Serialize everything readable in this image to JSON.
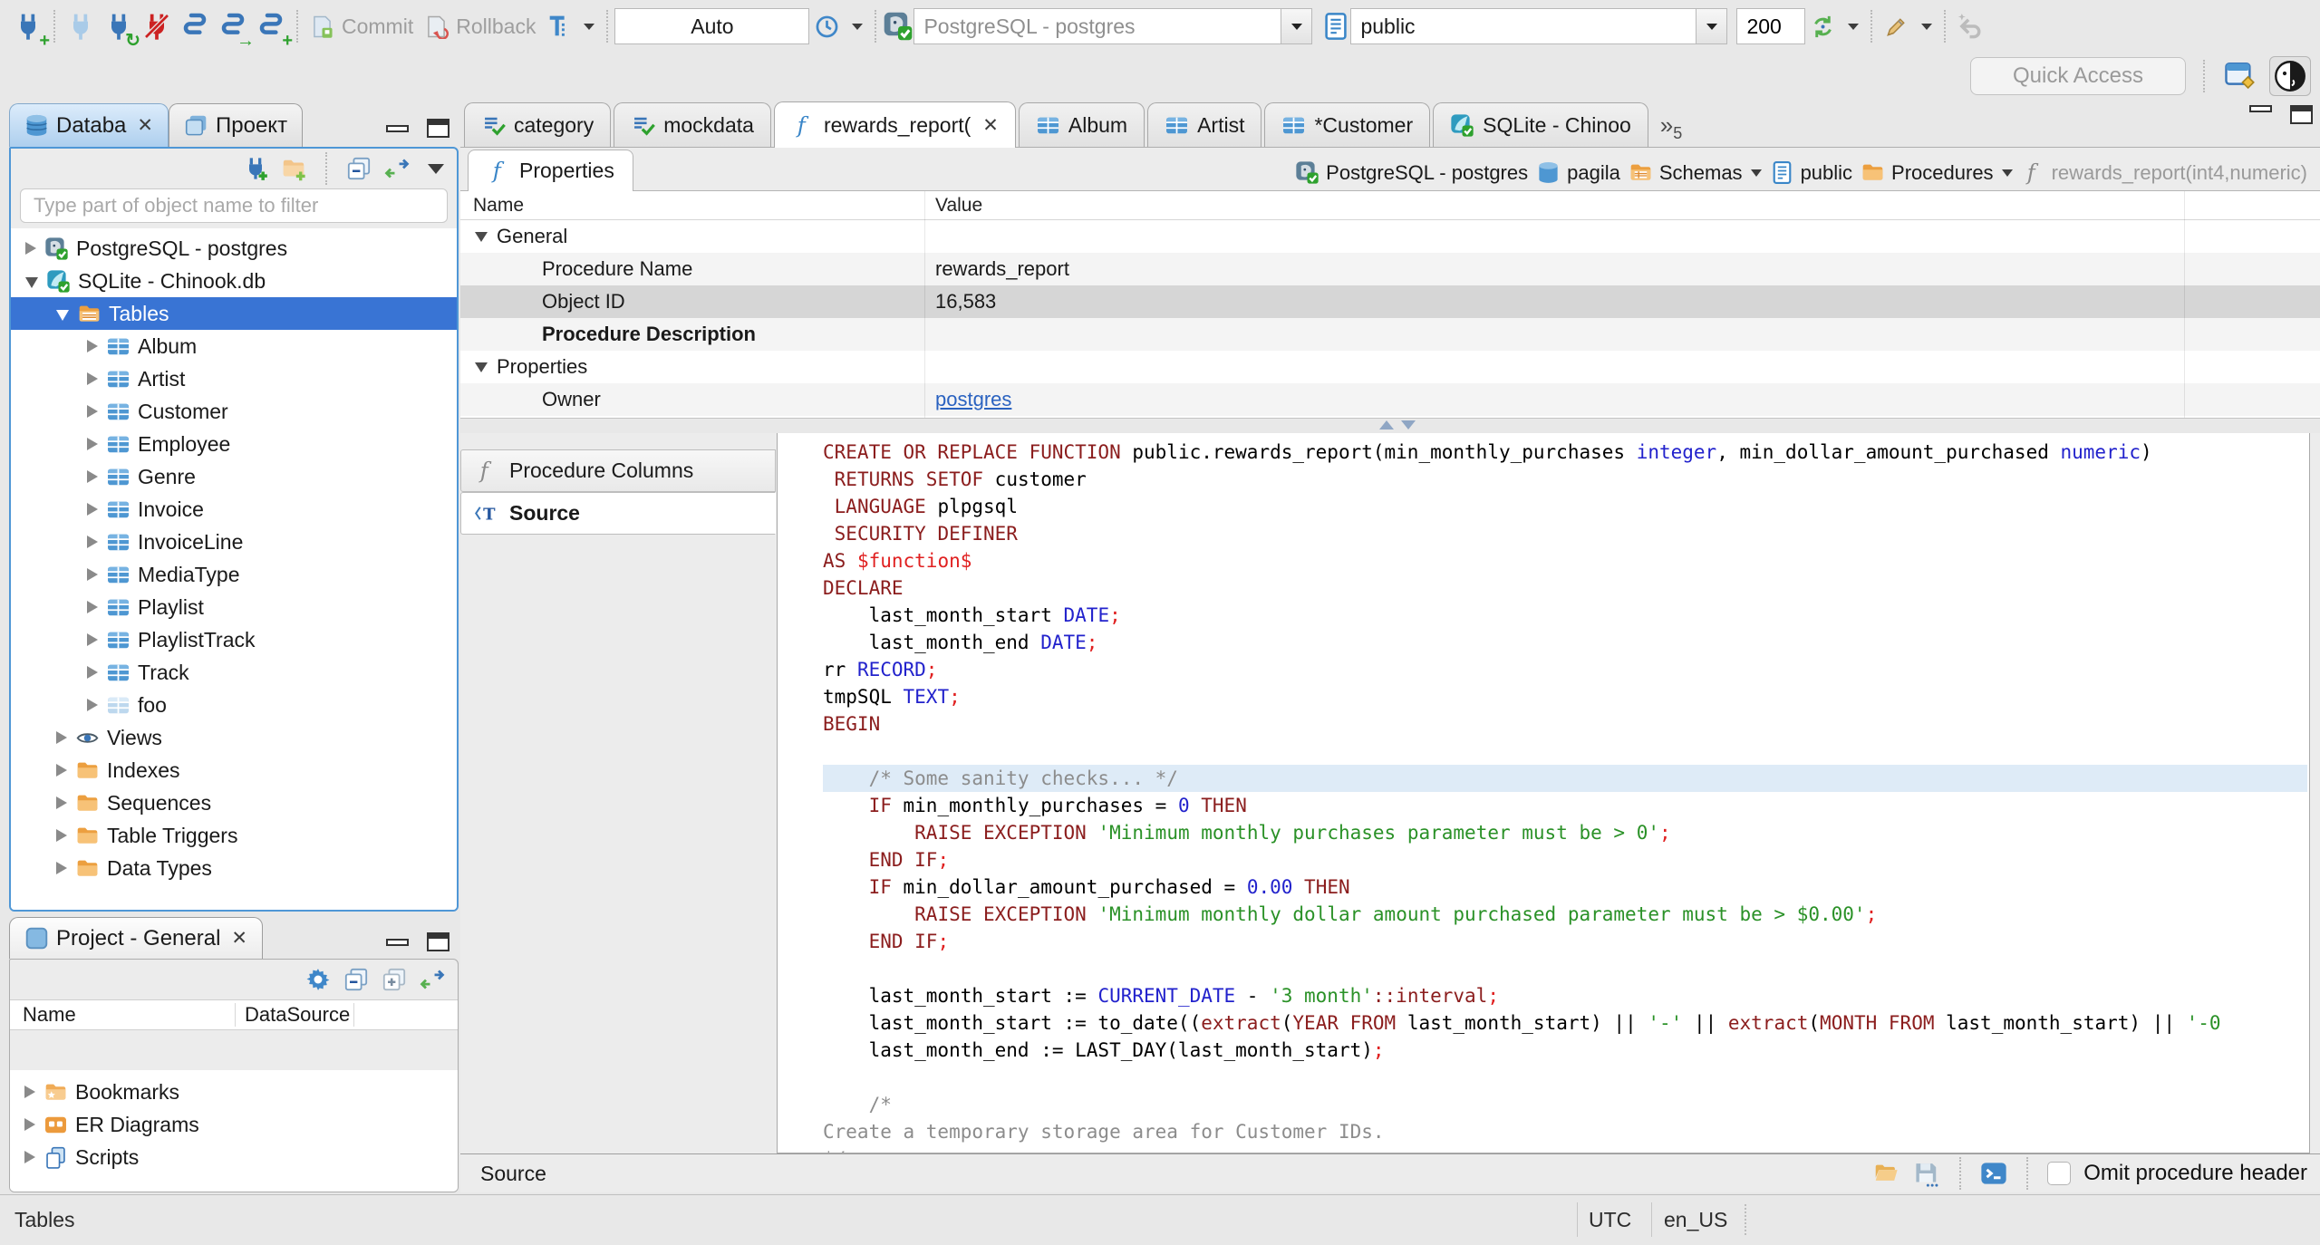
{
  "icons_glyphs": {
    "close": "✕",
    "more": "»",
    "refresh_badge": "↻",
    "plus_badge": "+"
  },
  "toolbar": {
    "commit_label": "Commit",
    "rollback_label": "Rollback",
    "auto_value": "Auto",
    "connection_value": "PostgreSQL - postgres",
    "schema_value": "public",
    "fetch_size_value": "200",
    "quick_access_placeholder": "Quick Access"
  },
  "navigator": {
    "tab_database": "Databa",
    "tab_project": "Проект",
    "filter_placeholder": "Type part of object name to filter",
    "tree": [
      {
        "label": "PostgreSQL - postgres",
        "depth": 0,
        "state": "collapsed",
        "icon": "pg"
      },
      {
        "label": "SQLite - Chinook.db",
        "depth": 0,
        "state": "expanded",
        "icon": "sqlite"
      },
      {
        "label": "Tables",
        "depth": 1,
        "state": "expanded",
        "icon": "tablesfolder",
        "selected": true
      },
      {
        "label": "Album",
        "depth": 2,
        "state": "collapsed",
        "icon": "table"
      },
      {
        "label": "Artist",
        "depth": 2,
        "state": "collapsed",
        "icon": "table"
      },
      {
        "label": "Customer",
        "depth": 2,
        "state": "collapsed",
        "icon": "table"
      },
      {
        "label": "Employee",
        "depth": 2,
        "state": "collapsed",
        "icon": "table"
      },
      {
        "label": "Genre",
        "depth": 2,
        "state": "collapsed",
        "icon": "table"
      },
      {
        "label": "Invoice",
        "depth": 2,
        "state": "collapsed",
        "icon": "table"
      },
      {
        "label": "InvoiceLine",
        "depth": 2,
        "state": "collapsed",
        "icon": "table"
      },
      {
        "label": "MediaType",
        "depth": 2,
        "state": "collapsed",
        "icon": "table"
      },
      {
        "label": "Playlist",
        "depth": 2,
        "state": "collapsed",
        "icon": "table"
      },
      {
        "label": "PlaylistTrack",
        "depth": 2,
        "state": "collapsed",
        "icon": "table"
      },
      {
        "label": "Track",
        "depth": 2,
        "state": "collapsed",
        "icon": "table"
      },
      {
        "label": "foo",
        "depth": 2,
        "state": "collapsed",
        "icon": "tablepale"
      },
      {
        "label": "Views",
        "depth": 1,
        "state": "collapsed",
        "icon": "views"
      },
      {
        "label": "Indexes",
        "depth": 1,
        "state": "collapsed",
        "icon": "folder"
      },
      {
        "label": "Sequences",
        "depth": 1,
        "state": "collapsed",
        "icon": "folder"
      },
      {
        "label": "Table Triggers",
        "depth": 1,
        "state": "collapsed",
        "icon": "folder"
      },
      {
        "label": "Data Types",
        "depth": 1,
        "state": "collapsed",
        "icon": "folder"
      }
    ]
  },
  "project_panel": {
    "title": "Project - General",
    "columns": [
      "Name",
      "DataSource"
    ],
    "tree": [
      {
        "label": "Bookmarks",
        "icon": "bookmarks"
      },
      {
        "label": "ER Diagrams",
        "icon": "erd"
      },
      {
        "label": "Scripts",
        "icon": "scripts"
      }
    ]
  },
  "editor": {
    "tabs": [
      {
        "label": "category",
        "icon": "script"
      },
      {
        "label": "mockdata",
        "icon": "script"
      },
      {
        "label": "rewards_report(",
        "icon": "fx",
        "active": true,
        "closable": true
      },
      {
        "label": "Album",
        "icon": "table"
      },
      {
        "label": "Artist",
        "icon": "table"
      },
      {
        "label": "*Customer",
        "icon": "table"
      },
      {
        "label": "SQLite - Chinoo",
        "icon": "sqlite"
      }
    ],
    "hidden_tabs_count": "5",
    "properties_tab_label": "Properties",
    "breadcrumb": [
      {
        "label": "PostgreSQL - postgres",
        "icon": "pg"
      },
      {
        "label": "pagila",
        "icon": "dbcyl"
      },
      {
        "label": "Schemas",
        "icon": "schemafolder",
        "caret": true
      },
      {
        "label": "public",
        "icon": "page"
      },
      {
        "label": "Procedures",
        "icon": "folder",
        "caret": true
      },
      {
        "label": "rewards_report(int4,numeric)",
        "icon": "fxgray",
        "dim": true
      }
    ],
    "grid": {
      "name_col": "Name",
      "value_col": "Value",
      "rows": [
        {
          "kind": "group",
          "name": "General"
        },
        {
          "kind": "item",
          "name": "Procedure Name",
          "value": "rewards_report"
        },
        {
          "kind": "item",
          "name": "Object ID",
          "value": "16,583",
          "selected": true
        },
        {
          "kind": "item",
          "name": "Procedure Description",
          "value": "",
          "bold": true
        },
        {
          "kind": "group",
          "name": "Properties"
        },
        {
          "kind": "item",
          "name": "Owner",
          "value": "postgres",
          "link": true
        }
      ]
    },
    "subtabs": [
      {
        "label": "Procedure Columns",
        "icon": "fxgray"
      },
      {
        "label": "Source",
        "icon": "sourceT",
        "active": true
      }
    ],
    "source_lines": [
      {
        "hl": false,
        "tokens": [
          [
            "k",
            "CREATE OR REPLACE FUNCTION"
          ],
          [
            "p",
            " public.rewards_report(min_monthly_purchases "
          ],
          [
            "t",
            "integer"
          ],
          [
            "p",
            ", min_dollar_amount_purchased "
          ],
          [
            "t",
            "numeric"
          ],
          [
            "p",
            ")"
          ]
        ]
      },
      {
        "hl": false,
        "tokens": [
          [
            "p",
            " "
          ],
          [
            "k",
            "RETURNS SETOF"
          ],
          [
            "p",
            " customer"
          ]
        ]
      },
      {
        "hl": false,
        "tokens": [
          [
            "p",
            " "
          ],
          [
            "k",
            "LANGUAGE"
          ],
          [
            "p",
            " plpgsql"
          ]
        ]
      },
      {
        "hl": false,
        "tokens": [
          [
            "p",
            " "
          ],
          [
            "k",
            "SECURITY DEFINER"
          ]
        ]
      },
      {
        "hl": false,
        "tokens": [
          [
            "k",
            "AS"
          ],
          [
            "r",
            " $function$"
          ]
        ]
      },
      {
        "hl": false,
        "tokens": [
          [
            "k",
            "DECLARE"
          ]
        ]
      },
      {
        "hl": false,
        "tokens": [
          [
            "p",
            "    last_month_start "
          ],
          [
            "t",
            "DATE"
          ],
          [
            "r",
            ";"
          ]
        ]
      },
      {
        "hl": false,
        "tokens": [
          [
            "p",
            "    last_month_end "
          ],
          [
            "t",
            "DATE"
          ],
          [
            "r",
            ";"
          ]
        ]
      },
      {
        "hl": false,
        "tokens": [
          [
            "p",
            "rr "
          ],
          [
            "t",
            "RECORD"
          ],
          [
            "r",
            ";"
          ]
        ]
      },
      {
        "hl": false,
        "tokens": [
          [
            "p",
            "tmpSQL "
          ],
          [
            "t",
            "TEXT"
          ],
          [
            "r",
            ";"
          ]
        ]
      },
      {
        "hl": false,
        "tokens": [
          [
            "k",
            "BEGIN"
          ]
        ]
      },
      {
        "hl": false,
        "tokens": []
      },
      {
        "hl": true,
        "tokens": [
          [
            "c",
            "    /* Some sanity checks... */"
          ]
        ]
      },
      {
        "hl": false,
        "tokens": [
          [
            "p",
            "    "
          ],
          [
            "k",
            "IF"
          ],
          [
            "p",
            " min_monthly_purchases = "
          ],
          [
            "n",
            "0"
          ],
          [
            "p",
            " "
          ],
          [
            "k",
            "THEN"
          ]
        ]
      },
      {
        "hl": false,
        "tokens": [
          [
            "p",
            "        "
          ],
          [
            "k",
            "RAISE EXCEPTION"
          ],
          [
            "p",
            " "
          ],
          [
            "s",
            "'Minimum monthly purchases parameter must be > 0'"
          ],
          [
            "r",
            ";"
          ]
        ]
      },
      {
        "hl": false,
        "tokens": [
          [
            "p",
            "    "
          ],
          [
            "k",
            "END IF"
          ],
          [
            "r",
            ";"
          ]
        ]
      },
      {
        "hl": false,
        "tokens": [
          [
            "p",
            "    "
          ],
          [
            "k",
            "IF"
          ],
          [
            "p",
            " min_dollar_amount_purchased = "
          ],
          [
            "n",
            "0.00"
          ],
          [
            "p",
            " "
          ],
          [
            "k",
            "THEN"
          ]
        ]
      },
      {
        "hl": false,
        "tokens": [
          [
            "p",
            "        "
          ],
          [
            "k",
            "RAISE EXCEPTION"
          ],
          [
            "p",
            " "
          ],
          [
            "s",
            "'Minimum monthly dollar amount purchased parameter must be > $0.00'"
          ],
          [
            "r",
            ";"
          ]
        ]
      },
      {
        "hl": false,
        "tokens": [
          [
            "p",
            "    "
          ],
          [
            "k",
            "END IF"
          ],
          [
            "r",
            ";"
          ]
        ]
      },
      {
        "hl": false,
        "tokens": []
      },
      {
        "hl": false,
        "tokens": [
          [
            "p",
            "    last_month_start := "
          ],
          [
            "t",
            "CURRENT_DATE"
          ],
          [
            "p",
            " - "
          ],
          [
            "s",
            "'3 month'"
          ],
          [
            "k",
            "::interval"
          ],
          [
            "r",
            ";"
          ]
        ]
      },
      {
        "hl": false,
        "tokens": [
          [
            "p",
            "    last_month_start := to_date(("
          ],
          [
            "k",
            "extract"
          ],
          [
            "p",
            "("
          ],
          [
            "k",
            "YEAR FROM"
          ],
          [
            "p",
            " last_month_start) || "
          ],
          [
            "s",
            "'-'"
          ],
          [
            "p",
            " || "
          ],
          [
            "k",
            "extract"
          ],
          [
            "p",
            "("
          ],
          [
            "k",
            "MONTH FROM"
          ],
          [
            "p",
            " last_month_start) || "
          ],
          [
            "s",
            "'-0"
          ]
        ]
      },
      {
        "hl": false,
        "tokens": [
          [
            "p",
            "    last_month_end := LAST_DAY(last_month_start)"
          ],
          [
            "r",
            ";"
          ]
        ]
      },
      {
        "hl": false,
        "tokens": []
      },
      {
        "hl": false,
        "tokens": [
          [
            "c",
            "    /*"
          ]
        ]
      },
      {
        "hl": false,
        "tokens": [
          [
            "c",
            "Create a temporary storage area for Customer IDs."
          ]
        ]
      },
      {
        "hl": false,
        "tokens": [
          [
            "c",
            "*/"
          ]
        ]
      }
    ],
    "footer": {
      "label": "Source",
      "omit_checkbox_label": "Omit procedure header"
    }
  },
  "statusbar": {
    "left": "Tables",
    "timezone": "UTC",
    "locale": "en_US"
  }
}
